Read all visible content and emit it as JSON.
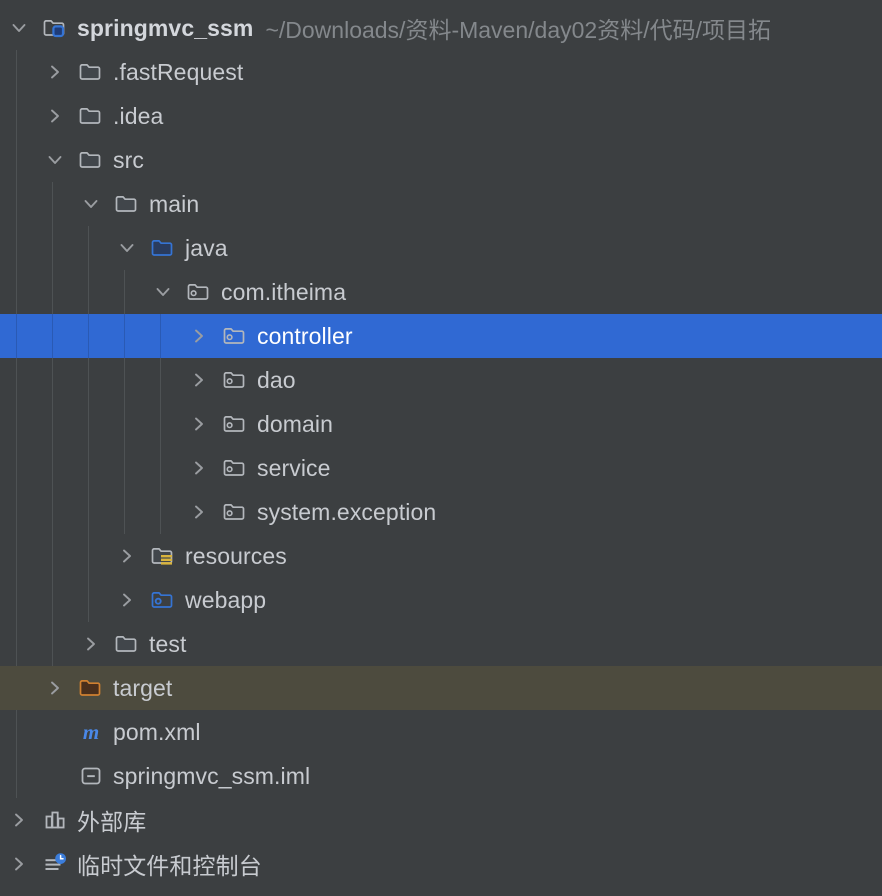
{
  "window": {
    "theme": "darcula",
    "background": "#3c3f41",
    "selection_color": "#3069d3",
    "excluded_row_color": "#4d4b3e",
    "text_color": "#c8cbd0",
    "muted_text_color": "#84888c"
  },
  "project_tree": {
    "root": {
      "label": "springmvc_ssm",
      "path": "~/Downloads/资料-Maven/day02资料/代码/项目拓",
      "icon": "project-module-folder-icon",
      "expanded": true
    },
    "nodes": [
      {
        "label": ".fastRequest",
        "icon": "folder-icon",
        "depth": 1,
        "chevron": "right",
        "state": "normal"
      },
      {
        "label": ".idea",
        "icon": "folder-icon",
        "depth": 1,
        "chevron": "right",
        "state": "normal"
      },
      {
        "label": "src",
        "icon": "folder-icon",
        "depth": 1,
        "chevron": "down",
        "state": "normal"
      },
      {
        "label": "main",
        "icon": "folder-icon",
        "depth": 2,
        "chevron": "down",
        "state": "normal"
      },
      {
        "label": "java",
        "icon": "source-root-folder-icon",
        "depth": 3,
        "chevron": "down",
        "state": "normal"
      },
      {
        "label": "com.itheima",
        "icon": "package-icon",
        "depth": 4,
        "chevron": "down",
        "state": "normal"
      },
      {
        "label": "controller",
        "icon": "package-icon",
        "depth": 5,
        "chevron": "right",
        "state": "selected"
      },
      {
        "label": "dao",
        "icon": "package-icon",
        "depth": 5,
        "chevron": "right",
        "state": "normal"
      },
      {
        "label": "domain",
        "icon": "package-icon",
        "depth": 5,
        "chevron": "right",
        "state": "normal"
      },
      {
        "label": "service",
        "icon": "package-icon",
        "depth": 5,
        "chevron": "right",
        "state": "normal"
      },
      {
        "label": "system.exception",
        "icon": "package-icon",
        "depth": 5,
        "chevron": "right",
        "state": "normal"
      },
      {
        "label": "resources",
        "icon": "resource-root-folder-icon",
        "depth": 3,
        "chevron": "right",
        "state": "normal"
      },
      {
        "label": "webapp",
        "icon": "web-root-folder-icon",
        "depth": 3,
        "chevron": "right",
        "state": "normal"
      },
      {
        "label": "test",
        "icon": "folder-icon",
        "depth": 2,
        "chevron": "right",
        "state": "normal"
      },
      {
        "label": "target",
        "icon": "excluded-folder-icon",
        "depth": 1,
        "chevron": "right",
        "state": "excluded"
      },
      {
        "label": "pom.xml",
        "icon": "maven-file-icon",
        "depth": 1,
        "chevron": "none",
        "state": "normal"
      },
      {
        "label": "springmvc_ssm.iml",
        "icon": "iml-file-icon",
        "depth": 1,
        "chevron": "none",
        "state": "normal"
      },
      {
        "label": "外部库",
        "icon": "external-libraries-icon",
        "depth": 0,
        "chevron": "right",
        "state": "normal",
        "cjk": true
      },
      {
        "label": "临时文件和控制台",
        "icon": "scratches-consoles-icon",
        "depth": 0,
        "chevron": "right",
        "state": "normal",
        "cjk": true
      }
    ]
  },
  "icon_colors": {
    "folder_outline": "#b3b7bc",
    "folder_fill": "#41464b",
    "source_root_blue": "#3574d4",
    "resource_gold": "#d9b43c",
    "web_blue": "#3574d4",
    "excluded_orange": "#d08030",
    "excluded_fill": "#4a2f1c",
    "maven_m": "#4a88e8",
    "chevron": "#9a9da1",
    "clock_badge_blue": "#3b7ddb"
  }
}
